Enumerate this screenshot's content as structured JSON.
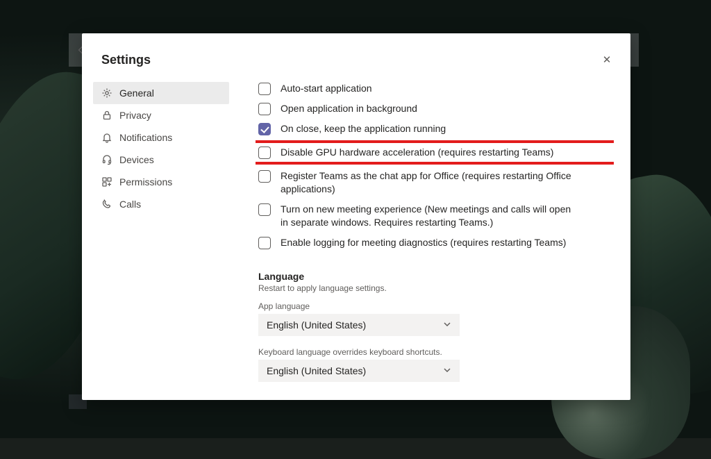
{
  "dialog": {
    "title": "Settings"
  },
  "sidebar": {
    "items": [
      {
        "label": "General",
        "icon": "gear-icon",
        "active": true
      },
      {
        "label": "Privacy",
        "icon": "lock-icon",
        "active": false
      },
      {
        "label": "Notifications",
        "icon": "bell-icon",
        "active": false
      },
      {
        "label": "Devices",
        "icon": "headset-icon",
        "active": false
      },
      {
        "label": "Permissions",
        "icon": "apps-icon",
        "active": false
      },
      {
        "label": "Calls",
        "icon": "phone-icon",
        "active": false
      }
    ]
  },
  "settings": {
    "checkboxes": [
      {
        "label": "Auto-start application",
        "checked": false,
        "highlighted": false
      },
      {
        "label": "Open application in background",
        "checked": false,
        "highlighted": false
      },
      {
        "label": "On close, keep the application running",
        "checked": true,
        "highlighted": false
      },
      {
        "label": "Disable GPU hardware acceleration (requires restarting Teams)",
        "checked": false,
        "highlighted": true
      },
      {
        "label": "Register Teams as the chat app for Office (requires restarting Office applications)",
        "checked": false,
        "highlighted": false
      },
      {
        "label": "Turn on new meeting experience (New meetings and calls will open in separate windows. Requires restarting Teams.)",
        "checked": false,
        "highlighted": false
      },
      {
        "label": "Enable logging for meeting diagnostics (requires restarting Teams)",
        "checked": false,
        "highlighted": false
      }
    ],
    "language": {
      "header": "Language",
      "restart_note": "Restart to apply language settings.",
      "app_language_label": "App language",
      "app_language_value": "English (United States)",
      "keyboard_label": "Keyboard language overrides keyboard shortcuts.",
      "keyboard_value": "English (United States)"
    }
  }
}
